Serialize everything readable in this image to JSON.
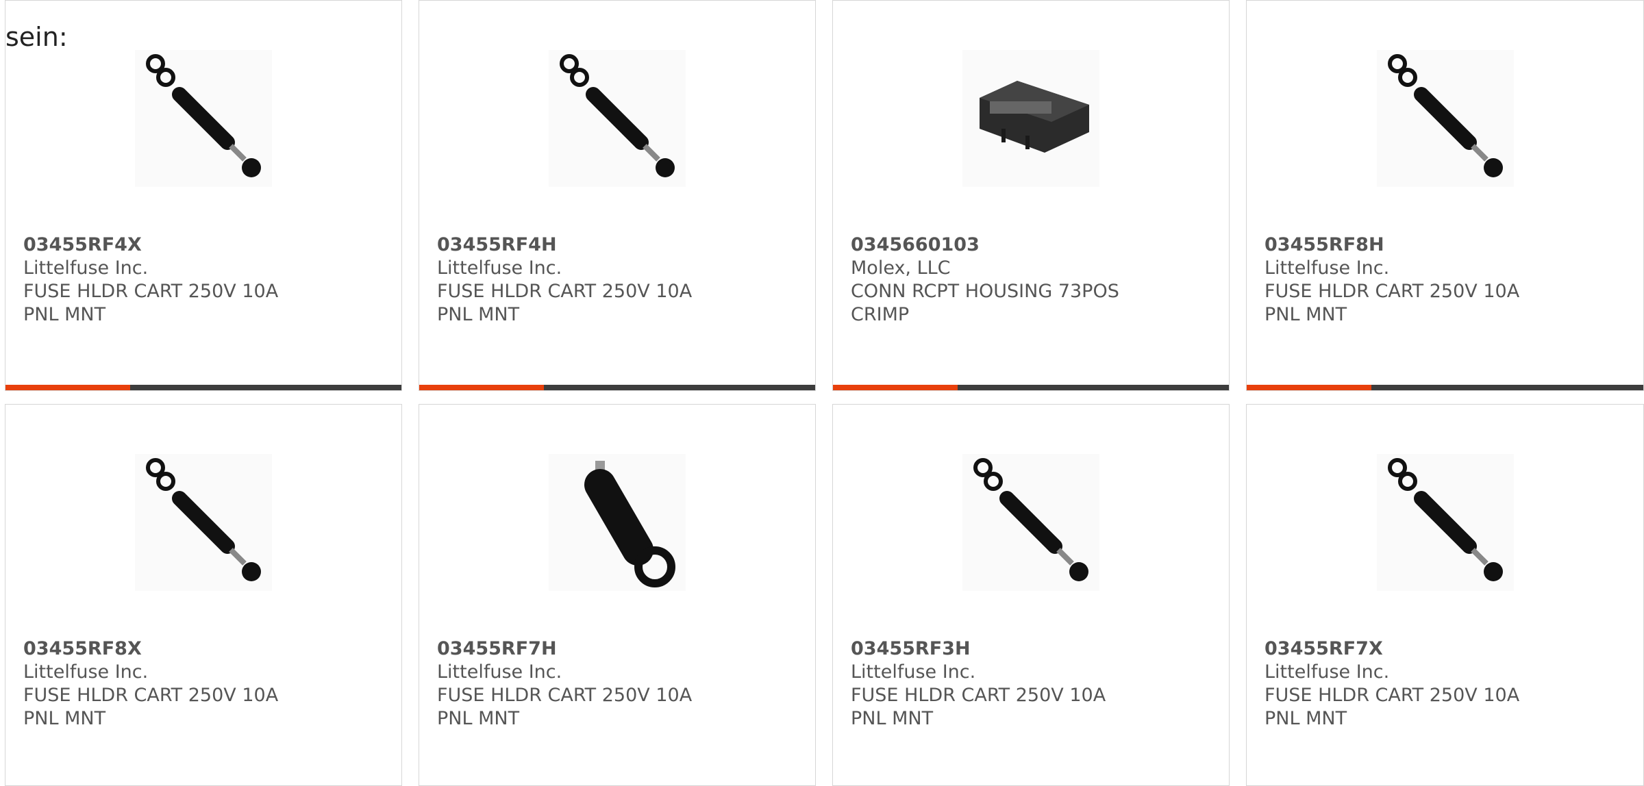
{
  "intro": {
    "text": "sein:"
  },
  "colors": {
    "accent": "#e8400c",
    "bar": "#3d3d3d",
    "border": "#d6d6d6",
    "text": "#555555"
  },
  "products": [
    {
      "part_number": "03455RF4X",
      "manufacturer": "Littelfuse Inc.",
      "description": "FUSE HLDR CART 250V 10A PNL MNT",
      "image": "fuse-holder-icon"
    },
    {
      "part_number": "03455RF4H",
      "manufacturer": "Littelfuse Inc.",
      "description": "FUSE HLDR CART 250V 10A PNL MNT",
      "image": "fuse-holder-icon"
    },
    {
      "part_number": "0345660103",
      "manufacturer": "Molex, LLC",
      "description": "CONN RCPT HOUSING 73POS CRIMP",
      "image": "connector-housing-icon"
    },
    {
      "part_number": "03455RF8H",
      "manufacturer": "Littelfuse Inc.",
      "description": "FUSE HLDR CART 250V 10A PNL MNT",
      "image": "fuse-holder-icon"
    },
    {
      "part_number": "03455RF8X",
      "manufacturer": "Littelfuse Inc.",
      "description": "FUSE HLDR CART 250V 10A PNL MNT",
      "image": "fuse-holder-icon"
    },
    {
      "part_number": "03455RF7H",
      "manufacturer": "Littelfuse Inc.",
      "description": "FUSE HLDR CART 250V 10A PNL MNT",
      "image": "fuse-holder-tab-icon"
    },
    {
      "part_number": "03455RF3H",
      "manufacturer": "Littelfuse Inc.",
      "description": "FUSE HLDR CART 250V 10A PNL MNT",
      "image": "fuse-holder-icon"
    },
    {
      "part_number": "03455RF7X",
      "manufacturer": "Littelfuse Inc.",
      "description": "FUSE HLDR CART 250V 10A PNL MNT",
      "image": "fuse-holder-icon"
    }
  ]
}
